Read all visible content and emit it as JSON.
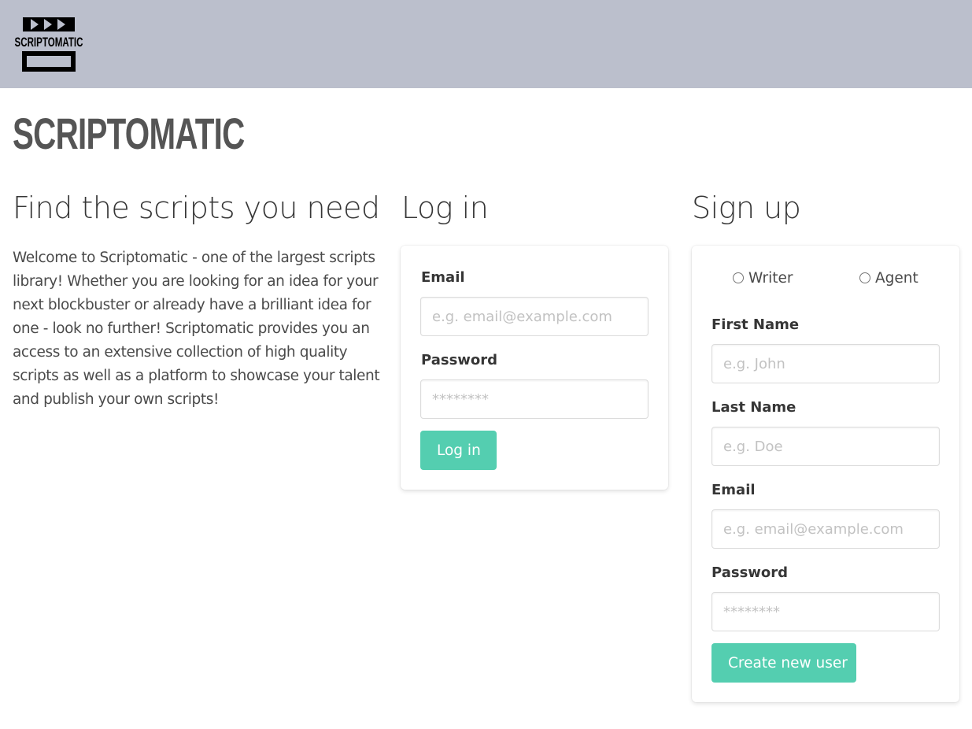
{
  "brand": {
    "logo_text": "SCRIPTOMATIC",
    "site_title": "SCRIPTOMATIC"
  },
  "intro": {
    "heading": "Find the scripts you need",
    "text": "Welcome to Scriptomatic - one of the largest scripts library! Whether you are looking for an idea for your next blockbuster or already have a brilliant idea for one - look no further! Scriptomatic provides you an access to an extensive collection of high quality scripts as well as a platform to showcase your talent and publish your own scripts!"
  },
  "login": {
    "heading": "Log in",
    "email_label": "Email",
    "email_placeholder": "e.g. email@example.com",
    "password_label": "Password",
    "password_placeholder": "********",
    "submit_label": "Log in"
  },
  "signup": {
    "heading": "Sign up",
    "role_options": [
      "Writer",
      "Agent"
    ],
    "first_name_label": "First Name",
    "first_name_placeholder": "e.g. John",
    "last_name_label": "Last Name",
    "last_name_placeholder": "e.g. Doe",
    "email_label": "Email",
    "email_placeholder": "e.g. email@example.com",
    "password_label": "Password",
    "password_placeholder": "********",
    "submit_label": "Create new user"
  },
  "colors": {
    "navbar_bg": "#bbbfcc",
    "primary_button": "#54ceb0"
  }
}
